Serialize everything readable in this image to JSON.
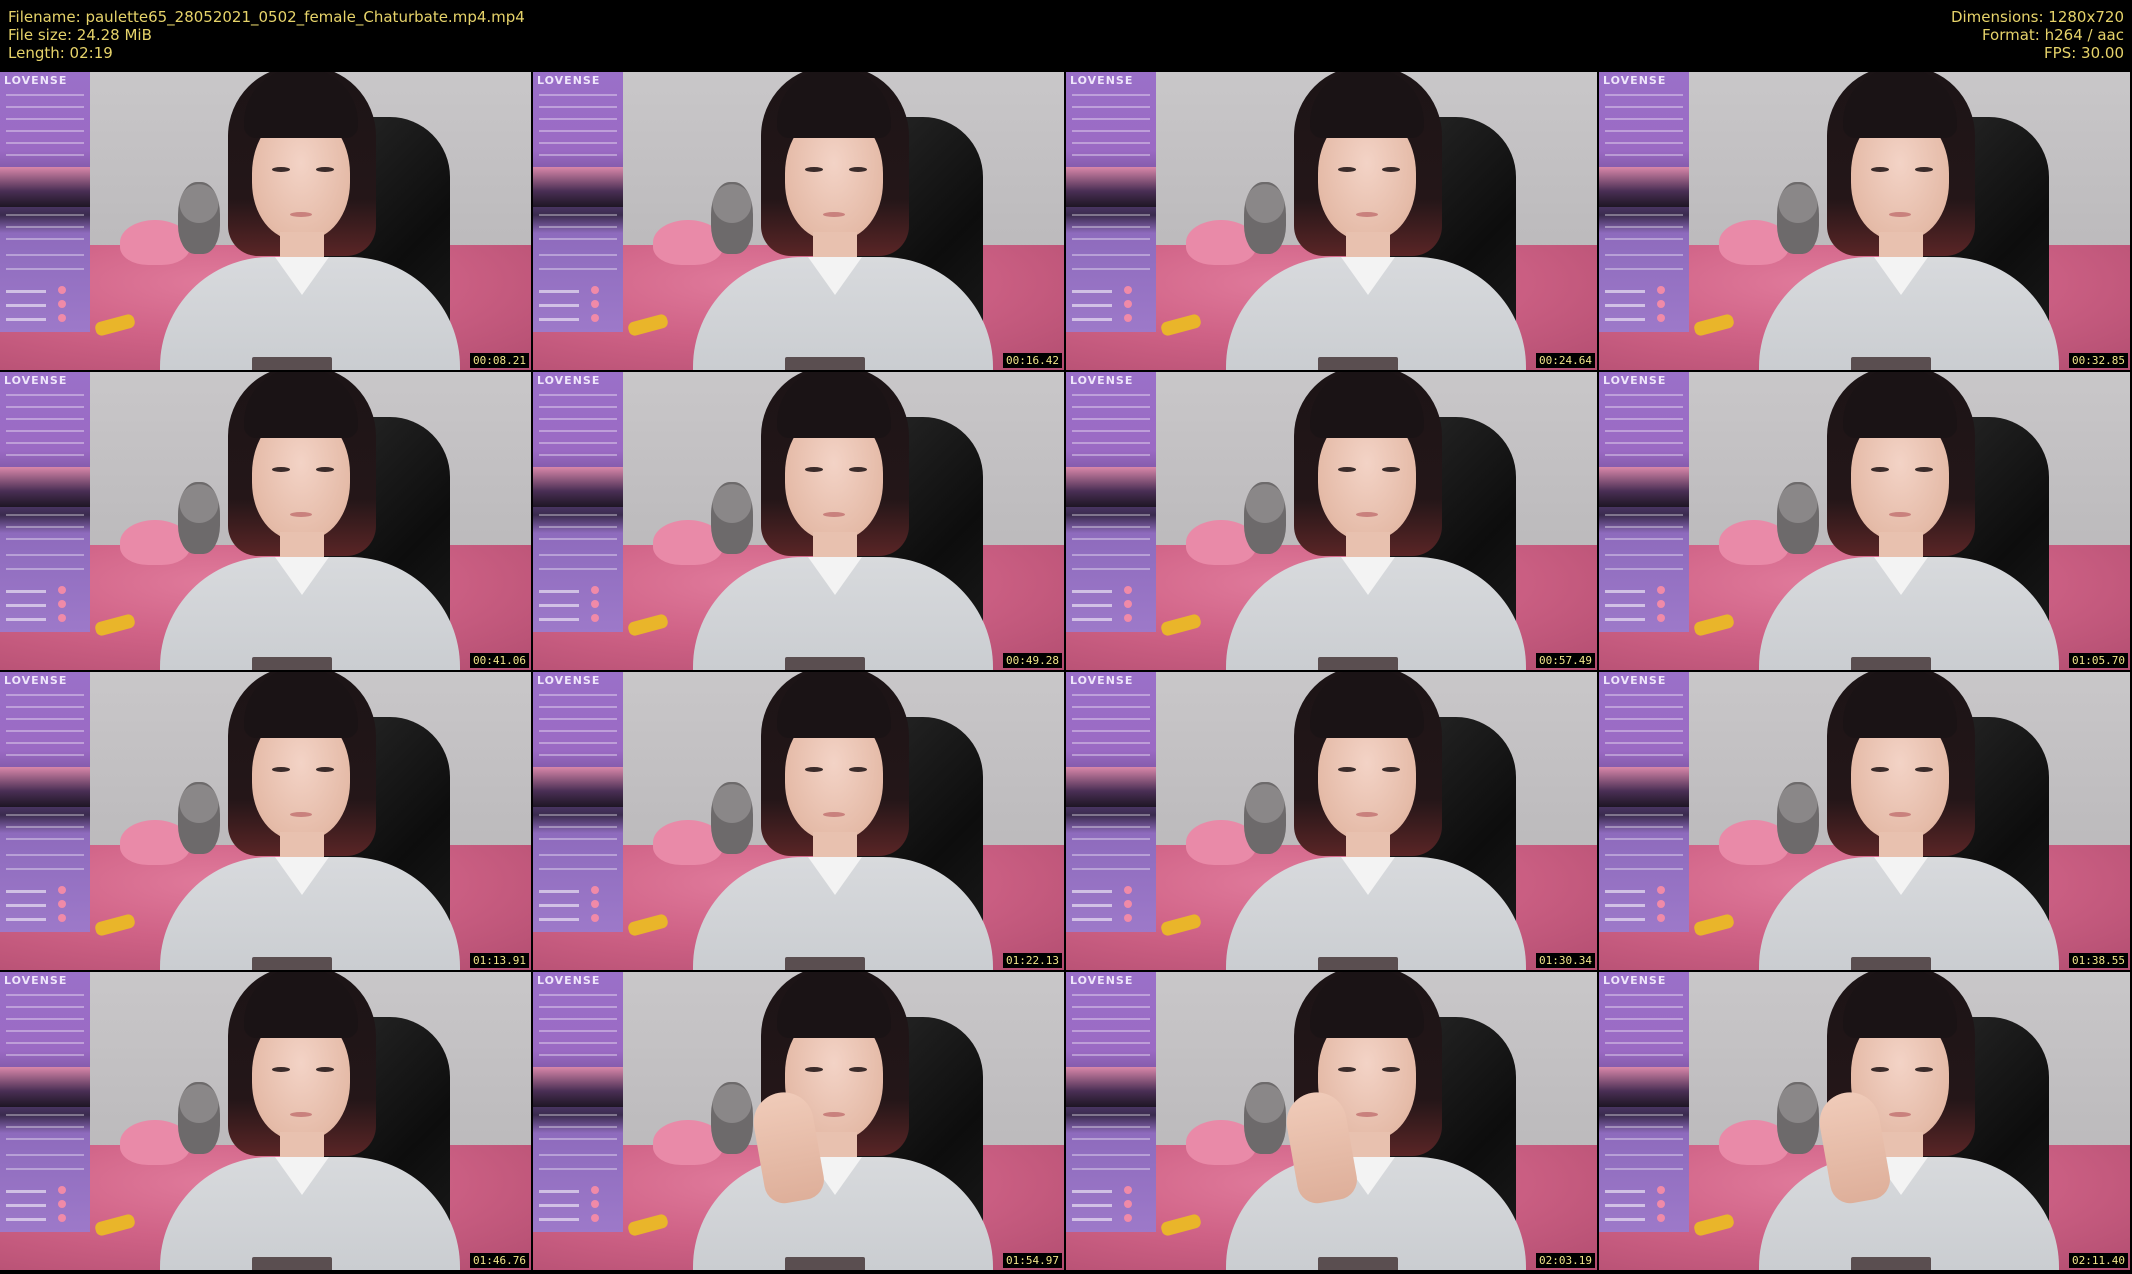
{
  "header": {
    "filename": "Filename: paulette65_28052021_0502_female_Chaturbate.mp4.mp4",
    "file_size": "File size: 24.28 MiB",
    "length": "Length: 02:19",
    "dimensions": "Dimensions: 1280x720",
    "format": "Format: h264 / aac",
    "fps": "FPS: 30.00"
  },
  "overlay_brand": "LOVENSE",
  "thumbnails": [
    {
      "time": "00:08.21"
    },
    {
      "time": "00:16.42"
    },
    {
      "time": "00:24.64"
    },
    {
      "time": "00:32.85"
    },
    {
      "time": "00:41.06"
    },
    {
      "time": "00:49.28"
    },
    {
      "time": "00:57.49"
    },
    {
      "time": "01:05.70"
    },
    {
      "time": "01:13.91"
    },
    {
      "time": "01:22.13"
    },
    {
      "time": "01:30.34"
    },
    {
      "time": "01:38.55"
    },
    {
      "time": "01:46.76"
    },
    {
      "time": "01:54.97"
    },
    {
      "time": "02:03.19"
    },
    {
      "time": "02:11.40"
    }
  ]
}
